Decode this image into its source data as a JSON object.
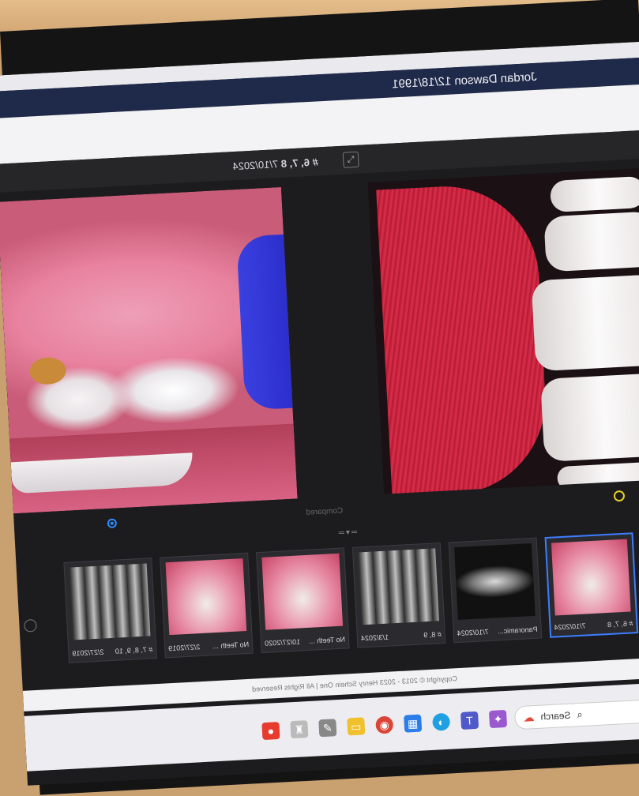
{
  "app": {
    "patient_label": "Jordan Dawson 12/18/1991"
  },
  "compare": {
    "header_teeth": "# 6, 7, 8",
    "header_date": "7/10/2024",
    "compare_word": "Compared",
    "expand_icon": "expand-icon"
  },
  "thumbnails": [
    {
      "label": "# 6, 7, 8",
      "date": "7/10/2024",
      "kind": "intraoral-pink",
      "selected": true
    },
    {
      "label": "Panoramic...",
      "date": "7/10/2024",
      "kind": "panoramic",
      "selected": false
    },
    {
      "label": "# 8, 9",
      "date": "1/3/2024",
      "kind": "xray",
      "selected": false
    },
    {
      "label": "No Teeth ...",
      "date": "10/27/2020",
      "kind": "intraoral-pink",
      "selected": false
    },
    {
      "label": "No Teeth ...",
      "date": "2/27/2019",
      "kind": "intraoral-pink",
      "selected": false
    },
    {
      "label": "# 7, 8, 9, 10",
      "date": "2/27/2019",
      "kind": "xray",
      "selected": false
    }
  ],
  "footer": {
    "copyright": "Copyright © 2013 - 2023 Henry Schein One | All Rights Reserved"
  },
  "taskbar": {
    "search_placeholder": "Search"
  },
  "colors": {
    "accent_blue": "#3c7dff",
    "header_navy": "#1f2a4a",
    "indicator_yellow": "#e7d21d"
  }
}
